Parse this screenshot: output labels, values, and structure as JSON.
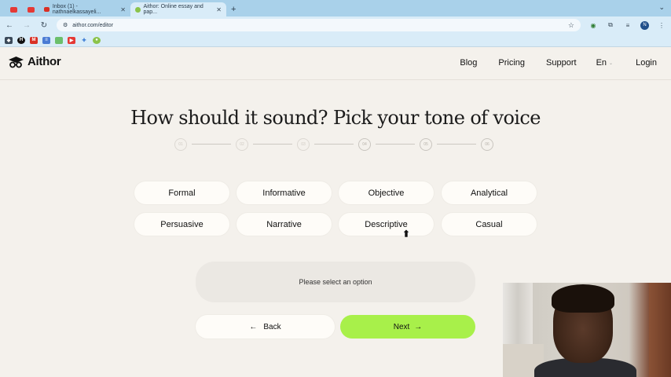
{
  "browser": {
    "tabs": [
      {
        "label": "",
        "favicon_color": "#e53935"
      },
      {
        "label": "",
        "favicon_color": "#e53935"
      },
      {
        "label": "Inbox (1) - nathnaelkassayeli...",
        "favicon_color": "#d93025"
      },
      {
        "label": "Aithor: Online essay and pap...",
        "favicon_color": "#8bc34a",
        "active": true
      }
    ],
    "new_tab": "+",
    "url": "aithor.com/editor"
  },
  "site": {
    "logo": "Aithor",
    "nav": {
      "blog": "Blog",
      "pricing": "Pricing",
      "support": "Support",
      "language": "En",
      "login": "Login"
    }
  },
  "page": {
    "title": "How should it sound? Pick your tone of voice",
    "steps": [
      "01",
      "02",
      "03",
      "04",
      "05",
      "06"
    ],
    "current_step": 4,
    "options": [
      "Formal",
      "Informative",
      "Objective",
      "Analytical",
      "Persuasive",
      "Narrative",
      "Descriptive",
      "Casual"
    ],
    "message": "Please select an option",
    "back_label": "Back",
    "next_label": "Next"
  },
  "colors": {
    "accent": "#a8f04a",
    "background": "#f4f1ec"
  }
}
